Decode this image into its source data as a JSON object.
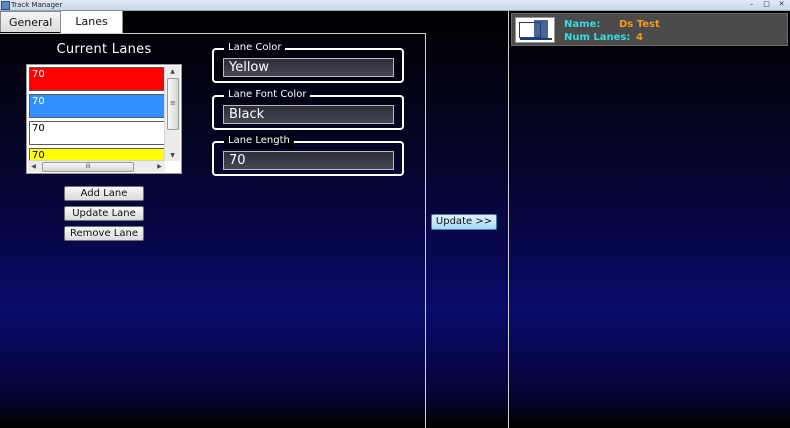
{
  "window": {
    "title": "Track Manager",
    "controls": [
      "–",
      "□",
      "✕"
    ]
  },
  "tabs": [
    {
      "label": "General",
      "active": false
    },
    {
      "label": "Lanes",
      "active": true
    }
  ],
  "current_lanes": {
    "title": "Current Lanes",
    "items": [
      {
        "text": "70",
        "color": "#ff0000",
        "font_color": "#ffffff"
      },
      {
        "text": "70",
        "color": "#3391ff",
        "font_color": "#ffffff"
      },
      {
        "text": "70",
        "color": "#ffffff",
        "font_color": "#000000"
      },
      {
        "text": "70",
        "color": "#ffff00",
        "font_color": "#000000"
      }
    ],
    "scroll_grip": "≡",
    "hscroll_grip": "III"
  },
  "buttons": {
    "add": "Add Lane",
    "update": "Update Lane",
    "remove": "Remove Lane",
    "update_track": "Update >>"
  },
  "fields": {
    "lane_color": {
      "label": "Lane Color",
      "value": "Yellow"
    },
    "lane_font_color": {
      "label": "Lane Font Color",
      "value": "Black"
    },
    "lane_length": {
      "label": "Lane Length",
      "value": "70"
    }
  },
  "track": {
    "name_label": "Name:",
    "name_value": "Ds Test",
    "lanes_label": "Num Lanes:",
    "lanes_value": "4"
  },
  "colors": {
    "name_label": "#37d9e6",
    "name_value": "#f39a1c",
    "update_button": "#a9d8f7"
  }
}
